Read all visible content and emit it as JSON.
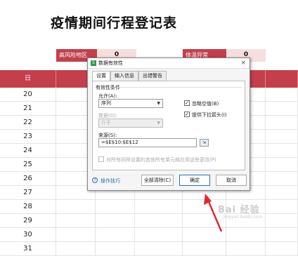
{
  "sheet": {
    "title": "疫情期间行程登记表",
    "summary": [
      {
        "label": "高风险地区",
        "value": "0"
      },
      {
        "label": "体温异常",
        "value": "0"
      }
    ],
    "header_first": "日",
    "rows": [
      "20",
      "21",
      "22",
      "23",
      "24",
      "25",
      "26",
      "27",
      "28",
      "29",
      "30",
      "31"
    ]
  },
  "dialog": {
    "title": "数据有效性",
    "icon_glyph": "S",
    "close_glyph": "×",
    "tabs": [
      {
        "label": "设置",
        "active": true
      },
      {
        "label": "输入信息",
        "active": false
      },
      {
        "label": "出错警告",
        "active": false
      }
    ],
    "group_title": "有效性条件",
    "allow_label": "允许(A):",
    "allow_value": "序列",
    "data_label": "数据(D):",
    "data_value": "介于",
    "ignore_blank": {
      "label": "忽略空值(B)",
      "checked": true
    },
    "dropdown_arrow": {
      "label": "提供下拉箭头(I)",
      "checked": true
    },
    "source_label": "来源(S):",
    "source_value": "=$E$10:$E$12",
    "apply_all": {
      "label": "对所有同样设置的其他所有单元格应用这些更改(P)",
      "checked": false
    },
    "tip_label": "操作技巧",
    "buttons": {
      "clear_all": "全部清除(C)",
      "ok": "确定",
      "cancel": "取消"
    }
  },
  "watermark": {
    "text": "Bai 经验",
    "sub": "jingyan.baidu.com"
  },
  "colors": {
    "accent": "#c33f4c",
    "arrow": "#e0282e"
  }
}
